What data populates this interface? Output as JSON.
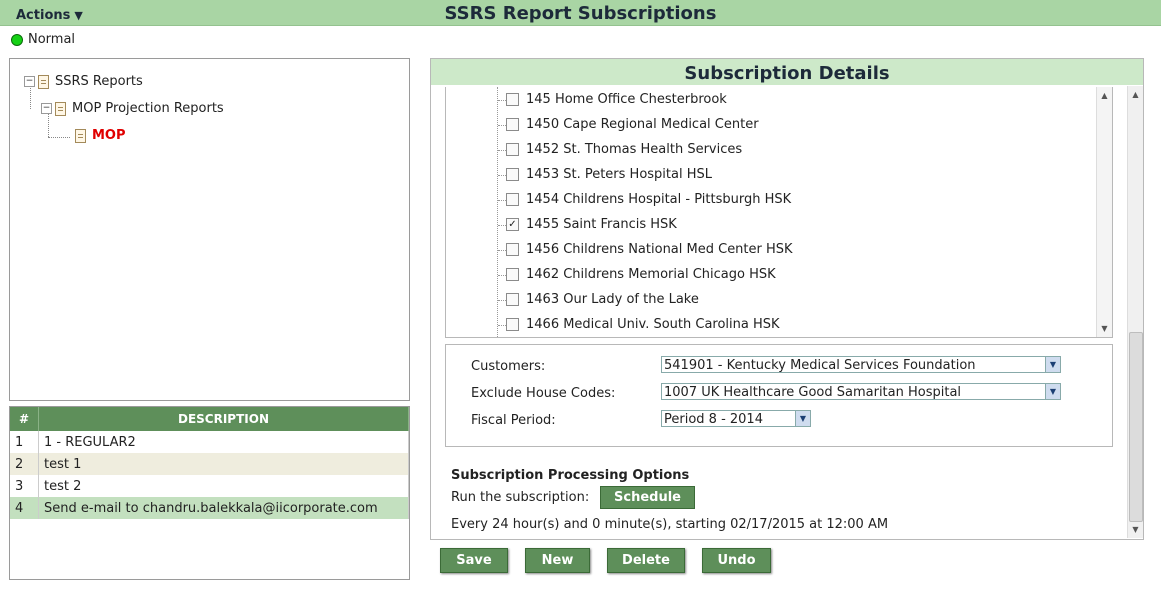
{
  "header": {
    "actions_label": "Actions",
    "title": "SSRS Report Subscriptions"
  },
  "status": {
    "label": "Normal",
    "color": "#15d115"
  },
  "tree": {
    "root": "SSRS Reports",
    "child": "MOP Projection Reports",
    "leaf": "MOP"
  },
  "history": {
    "columns": [
      "#",
      "DESCRIPTION"
    ],
    "rows": [
      {
        "num": "1",
        "desc": "1 - REGULAR2"
      },
      {
        "num": "2",
        "desc": "test 1"
      },
      {
        "num": "3",
        "desc": "test 2"
      },
      {
        "num": "4",
        "desc": "Send e-mail to chandru.balekkala@iicorporate.com"
      }
    ]
  },
  "details": {
    "title": "Subscription Details",
    "house_list": [
      {
        "label": "145 Home Office Chesterbrook",
        "checked": false
      },
      {
        "label": "1450 Cape Regional Medical Center",
        "checked": false
      },
      {
        "label": "1452 St. Thomas Health Services",
        "checked": false
      },
      {
        "label": "1453 St. Peters Hospital HSL",
        "checked": false
      },
      {
        "label": "1454 Childrens Hospital - Pittsburgh HSK",
        "checked": false
      },
      {
        "label": "1455 Saint Francis HSK",
        "checked": true
      },
      {
        "label": "1456 Childrens National Med Center HSK",
        "checked": false
      },
      {
        "label": "1462 Childrens Memorial Chicago HSK",
        "checked": false
      },
      {
        "label": "1463 Our Lady of the Lake",
        "checked": false
      },
      {
        "label": "1466 Medical Univ. South Carolina HSK",
        "checked": false
      }
    ],
    "filters": {
      "customers_label": "Customers:",
      "customers_value": "541901 - Kentucky Medical Services Foundation",
      "exclude_label": "Exclude House Codes:",
      "exclude_value": "1007 UK Healthcare Good Samaritan Hospital",
      "fiscal_label": "Fiscal Period:",
      "fiscal_value": "Period 8 - 2014"
    },
    "processing": {
      "title": "Subscription Processing Options",
      "run_label": "Run the subscription:",
      "schedule_button": "Schedule",
      "schedule_text": "Every 24 hour(s) and 0 minute(s), starting 02/17/2015 at 12:00 AM"
    }
  },
  "buttons": {
    "save": "Save",
    "new": "New",
    "delete": "Delete",
    "undo": "Undo"
  },
  "colors": {
    "topbar": "#a9d5a4",
    "accent_button": "#5e8f5a",
    "tree_selected": "#e00000"
  }
}
